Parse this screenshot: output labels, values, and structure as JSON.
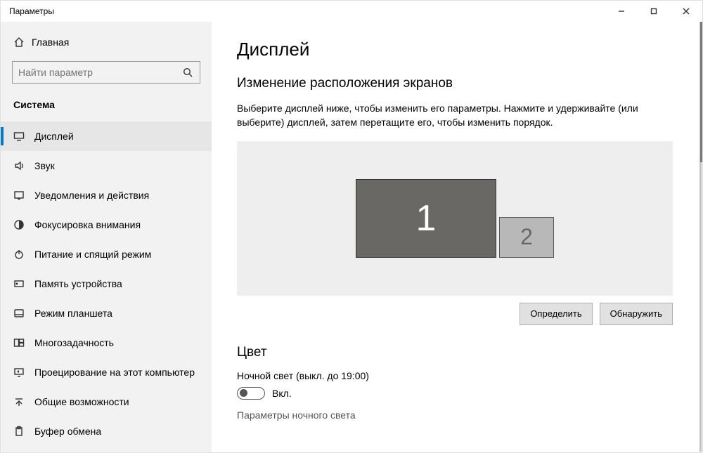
{
  "window": {
    "title": "Параметры"
  },
  "sidebar": {
    "home": "Главная",
    "search_placeholder": "Найти параметр",
    "category": "Система",
    "items": [
      {
        "label": "Дисплей",
        "active": true,
        "icon": "display-icon"
      },
      {
        "label": "Звук",
        "icon": "sound-icon"
      },
      {
        "label": "Уведомления и действия",
        "icon": "notifications-icon"
      },
      {
        "label": "Фокусировка внимания",
        "icon": "focus-icon"
      },
      {
        "label": "Питание и спящий режим",
        "icon": "power-icon"
      },
      {
        "label": "Память устройства",
        "icon": "storage-icon"
      },
      {
        "label": "Режим планшета",
        "icon": "tablet-icon"
      },
      {
        "label": "Многозадачность",
        "icon": "multitask-icon"
      },
      {
        "label": "Проецирование на этот компьютер",
        "icon": "projecting-icon"
      },
      {
        "label": "Общие возможности",
        "icon": "shared-icon"
      },
      {
        "label": "Буфер обмена",
        "icon": "clipboard-icon"
      }
    ]
  },
  "main": {
    "title": "Дисплей",
    "rearrange_heading": "Изменение расположения экранов",
    "rearrange_desc": "Выберите дисплей ниже, чтобы изменить его параметры. Нажмите и удерживайте (или выберите) дисплей, затем перетащите его, чтобы изменить порядок.",
    "monitors": {
      "m1": "1",
      "m2": "2"
    },
    "identify_btn": "Определить",
    "detect_btn": "Обнаружить",
    "color_heading": "Цвет",
    "night_light_label": "Ночной свет (выкл. до 19:00)",
    "toggle_label": "Вкл.",
    "night_light_settings_link": "Параметры ночного света"
  }
}
